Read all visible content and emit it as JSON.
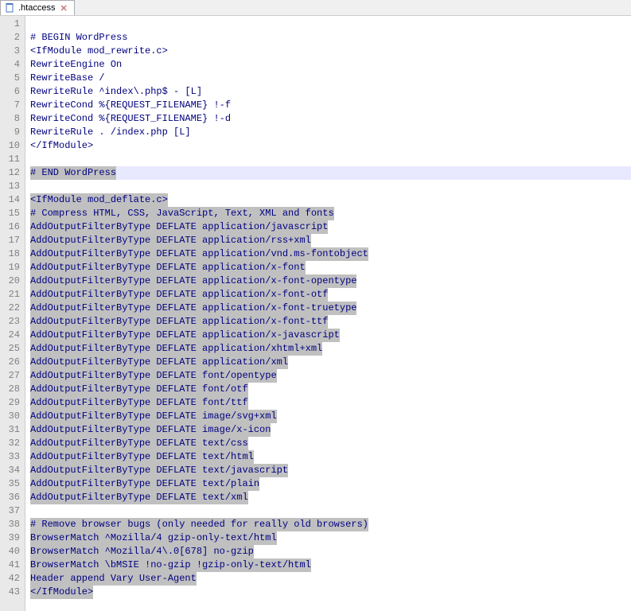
{
  "tab": {
    "filename": ".htaccess"
  },
  "editor": {
    "activeLine": 12,
    "lines": [
      {
        "n": 1,
        "text": "",
        "sel": false
      },
      {
        "n": 2,
        "text": "# BEGIN WordPress",
        "sel": false
      },
      {
        "n": 3,
        "text": "<IfModule mod_rewrite.c>",
        "sel": false
      },
      {
        "n": 4,
        "text": "RewriteEngine On",
        "sel": false
      },
      {
        "n": 5,
        "text": "RewriteBase /",
        "sel": false
      },
      {
        "n": 6,
        "text": "RewriteRule ^index\\.php$ - [L]",
        "sel": false
      },
      {
        "n": 7,
        "text": "RewriteCond %{REQUEST_FILENAME} !-f",
        "sel": false
      },
      {
        "n": 8,
        "text": "RewriteCond %{REQUEST_FILENAME} !-d",
        "sel": false
      },
      {
        "n": 9,
        "text": "RewriteRule . /index.php [L]",
        "sel": false
      },
      {
        "n": 10,
        "text": "</IfModule>",
        "sel": false
      },
      {
        "n": 11,
        "text": "",
        "sel": false
      },
      {
        "n": 12,
        "text": "# END WordPress",
        "sel": true,
        "active": true
      },
      {
        "n": 13,
        "text": "",
        "sel": false
      },
      {
        "n": 14,
        "text": "<IfModule mod_deflate.c>",
        "sel": true
      },
      {
        "n": 15,
        "text": "# Compress HTML, CSS, JavaScript, Text, XML and fonts",
        "sel": true
      },
      {
        "n": 16,
        "text": "AddOutputFilterByType DEFLATE application/javascript",
        "sel": true
      },
      {
        "n": 17,
        "text": "AddOutputFilterByType DEFLATE application/rss+xml",
        "sel": true
      },
      {
        "n": 18,
        "text": "AddOutputFilterByType DEFLATE application/vnd.ms-fontobject",
        "sel": true
      },
      {
        "n": 19,
        "text": "AddOutputFilterByType DEFLATE application/x-font",
        "sel": true
      },
      {
        "n": 20,
        "text": "AddOutputFilterByType DEFLATE application/x-font-opentype",
        "sel": true
      },
      {
        "n": 21,
        "text": "AddOutputFilterByType DEFLATE application/x-font-otf",
        "sel": true
      },
      {
        "n": 22,
        "text": "AddOutputFilterByType DEFLATE application/x-font-truetype",
        "sel": true
      },
      {
        "n": 23,
        "text": "AddOutputFilterByType DEFLATE application/x-font-ttf",
        "sel": true
      },
      {
        "n": 24,
        "text": "AddOutputFilterByType DEFLATE application/x-javascript",
        "sel": true
      },
      {
        "n": 25,
        "text": "AddOutputFilterByType DEFLATE application/xhtml+xml",
        "sel": true
      },
      {
        "n": 26,
        "text": "AddOutputFilterByType DEFLATE application/xml",
        "sel": true
      },
      {
        "n": 27,
        "text": "AddOutputFilterByType DEFLATE font/opentype",
        "sel": true
      },
      {
        "n": 28,
        "text": "AddOutputFilterByType DEFLATE font/otf",
        "sel": true
      },
      {
        "n": 29,
        "text": "AddOutputFilterByType DEFLATE font/ttf",
        "sel": true
      },
      {
        "n": 30,
        "text": "AddOutputFilterByType DEFLATE image/svg+xml",
        "sel": true
      },
      {
        "n": 31,
        "text": "AddOutputFilterByType DEFLATE image/x-icon",
        "sel": true
      },
      {
        "n": 32,
        "text": "AddOutputFilterByType DEFLATE text/css",
        "sel": true
      },
      {
        "n": 33,
        "text": "AddOutputFilterByType DEFLATE text/html",
        "sel": true
      },
      {
        "n": 34,
        "text": "AddOutputFilterByType DEFLATE text/javascript",
        "sel": true
      },
      {
        "n": 35,
        "text": "AddOutputFilterByType DEFLATE text/plain",
        "sel": true
      },
      {
        "n": 36,
        "text": "AddOutputFilterByType DEFLATE text/xml",
        "sel": true
      },
      {
        "n": 37,
        "text": "",
        "sel": false
      },
      {
        "n": 38,
        "text": "# Remove browser bugs (only needed for really old browsers)",
        "sel": true
      },
      {
        "n": 39,
        "text": "BrowserMatch ^Mozilla/4 gzip-only-text/html",
        "sel": true
      },
      {
        "n": 40,
        "text": "BrowserMatch ^Mozilla/4\\.0[678] no-gzip",
        "sel": true
      },
      {
        "n": 41,
        "text": "BrowserMatch \\bMSIE !no-gzip !gzip-only-text/html",
        "sel": true
      },
      {
        "n": 42,
        "text": "Header append Vary User-Agent",
        "sel": true
      },
      {
        "n": 43,
        "text": "</IfModule>",
        "sel": true
      }
    ]
  }
}
